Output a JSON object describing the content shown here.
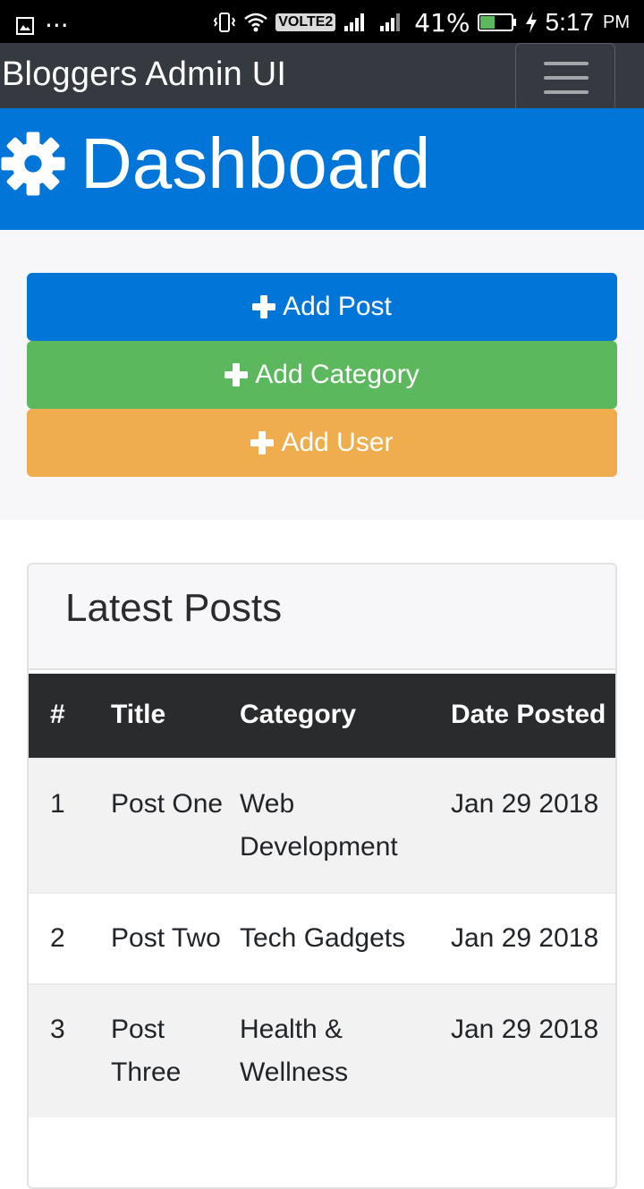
{
  "status_bar": {
    "dots": "···",
    "volte": "VOLTE2",
    "battery": "41%",
    "time": "5:17",
    "ampm": "PM"
  },
  "navbar": {
    "brand": "Bloggers Admin UI"
  },
  "header": {
    "title": "Dashboard"
  },
  "actions": {
    "add_post": "Add Post",
    "add_category": "Add Category",
    "add_user": "Add User"
  },
  "posts_card": {
    "title": "Latest Posts",
    "columns": [
      "#",
      "Title",
      "Category",
      "Date Posted"
    ],
    "rows": [
      {
        "num": "1",
        "title": "Post One",
        "category": "Web Development",
        "date": "Jan 29 2018"
      },
      {
        "num": "2",
        "title": "Post Two",
        "category": "Tech Gadgets",
        "date": "Jan 29 2018"
      },
      {
        "num": "3",
        "title": "Post Three",
        "category": "Health & Wellness",
        "date": "Jan 29 2018"
      }
    ]
  },
  "colors": {
    "primary": "#0275d8",
    "success": "#5cb85c",
    "warning": "#f0ad4e",
    "navbar": "#343a40",
    "table_head": "#292b2c"
  },
  "icons": {
    "header": "gear-icon",
    "buttons": "plus-icon",
    "navbar_toggler": "hamburger-icon"
  }
}
